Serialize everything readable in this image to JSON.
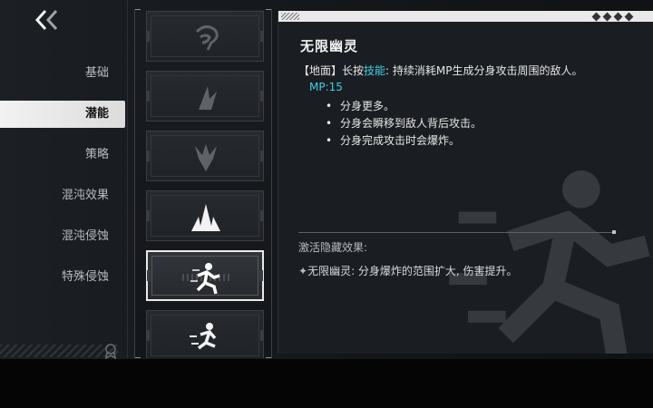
{
  "nav": {
    "back_icon": "double-chevron-left-icon"
  },
  "categories": [
    {
      "label": "基础",
      "active": false
    },
    {
      "label": "潜能",
      "active": true
    },
    {
      "label": "策略",
      "active": false
    },
    {
      "label": "混沌效果",
      "active": false
    },
    {
      "label": "混沌侵蚀",
      "active": false
    },
    {
      "label": "特殊侵蚀",
      "active": false
    }
  ],
  "skills": [
    {
      "icon": "spiral-claw-icon",
      "state": "dim"
    },
    {
      "icon": "slash-burst-icon",
      "state": "dim"
    },
    {
      "icon": "flame-burst-icon",
      "state": "dim"
    },
    {
      "icon": "spike-burst-icon",
      "state": "available"
    },
    {
      "icon": "phantom-runner-icon",
      "state": "selected"
    },
    {
      "icon": "dash-runner-icon",
      "state": "available"
    }
  ],
  "detail": {
    "title": "无限幽灵",
    "desc_tag": "【地面】",
    "desc_pre": "长按",
    "desc_keyword": "技能",
    "desc_post": ": 持续消耗MP生成分身攻击周围的敌人。",
    "mp": "MP:15",
    "bullets": [
      "分身更多。",
      "分身会瞬移到敌人背后攻击。",
      "分身完成攻击时会爆炸。"
    ],
    "hidden_title": "激活隐藏效果:",
    "hidden_prefix": "✦",
    "hidden_effect": "无限幽灵: 分身爆炸的范围扩大, 伤害提升。"
  },
  "colors": {
    "accent": "#3fd0e6",
    "active_bg": "#e9e9e9",
    "panel_bg": "#1a1d21"
  }
}
